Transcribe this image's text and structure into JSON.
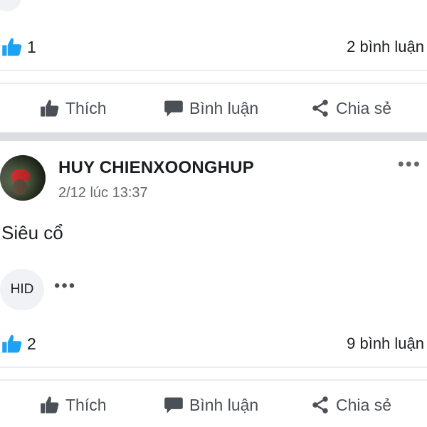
{
  "post1": {
    "like_count": "1",
    "comment_count": "2 bình luận"
  },
  "post2": {
    "author": "HUY CHIENXOONGHUP",
    "timestamp": "2/12 lúc 13:37",
    "text": "Siêu cổ",
    "reply_preview": "HID",
    "like_count": "2",
    "comment_count": "9 bình luận"
  },
  "actions": {
    "like": "Thích",
    "comment": "Bình luận",
    "share": "Chia sẻ"
  },
  "icons": {
    "like_badge": "thumbs-up-icon",
    "like": "thumbs-up-icon",
    "comment": "speech-bubble-icon",
    "share": "share-icon",
    "more": "ellipsis-icon"
  },
  "colors": {
    "like_blue": "#1da1f2",
    "action_gray": "#4b4f56",
    "divider": "#dcdde0"
  }
}
